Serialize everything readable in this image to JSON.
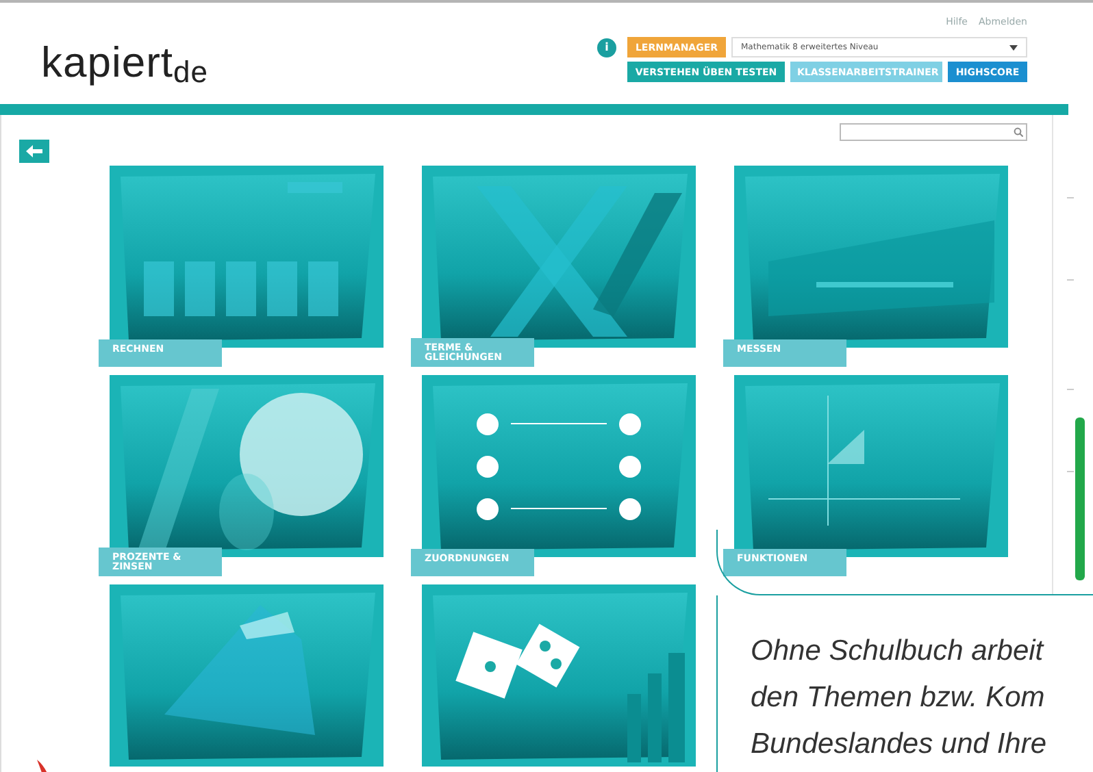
{
  "logo": {
    "name": "kapiert",
    "suffix": "de"
  },
  "top_links": [
    "Hilfe",
    "Abmelden"
  ],
  "info": {
    "symbol": "i"
  },
  "lernmanager": {
    "label": "LERNMANAGER"
  },
  "course_select": {
    "value": "Mathematik 8 erweitertes Niveau"
  },
  "nav": [
    {
      "label": "VERSTEHEN ÜBEN TESTEN",
      "color": "#1aa9a5"
    },
    {
      "label": "KLASSENARBEITSTRAINER",
      "color": "#7fd0e4"
    },
    {
      "label": "HIGHSCORE",
      "color": "#1b8fd0"
    }
  ],
  "tiles": [
    {
      "label": "RECHNEN",
      "kind": "picture"
    },
    {
      "label": "TERME & GLEICHUNGEN",
      "kind": "picture"
    },
    {
      "label": "MESSEN",
      "kind": "picture"
    },
    {
      "label": "PROZENTE & ZINSEN",
      "kind": "picture"
    },
    {
      "label": "ZUORDNUNGEN",
      "kind": "picture"
    },
    {
      "label": "FUNKTIONEN",
      "kind": "picture"
    },
    {
      "kind": "picture"
    },
    {
      "kind": "picture"
    }
  ],
  "progress": {
    "level": 0.35
  },
  "callout": {
    "lines": [
      "Ohne Schulbuch arbeit",
      "den Themen bzw. Kom",
      "Bundeslandes und Ihre"
    ]
  }
}
